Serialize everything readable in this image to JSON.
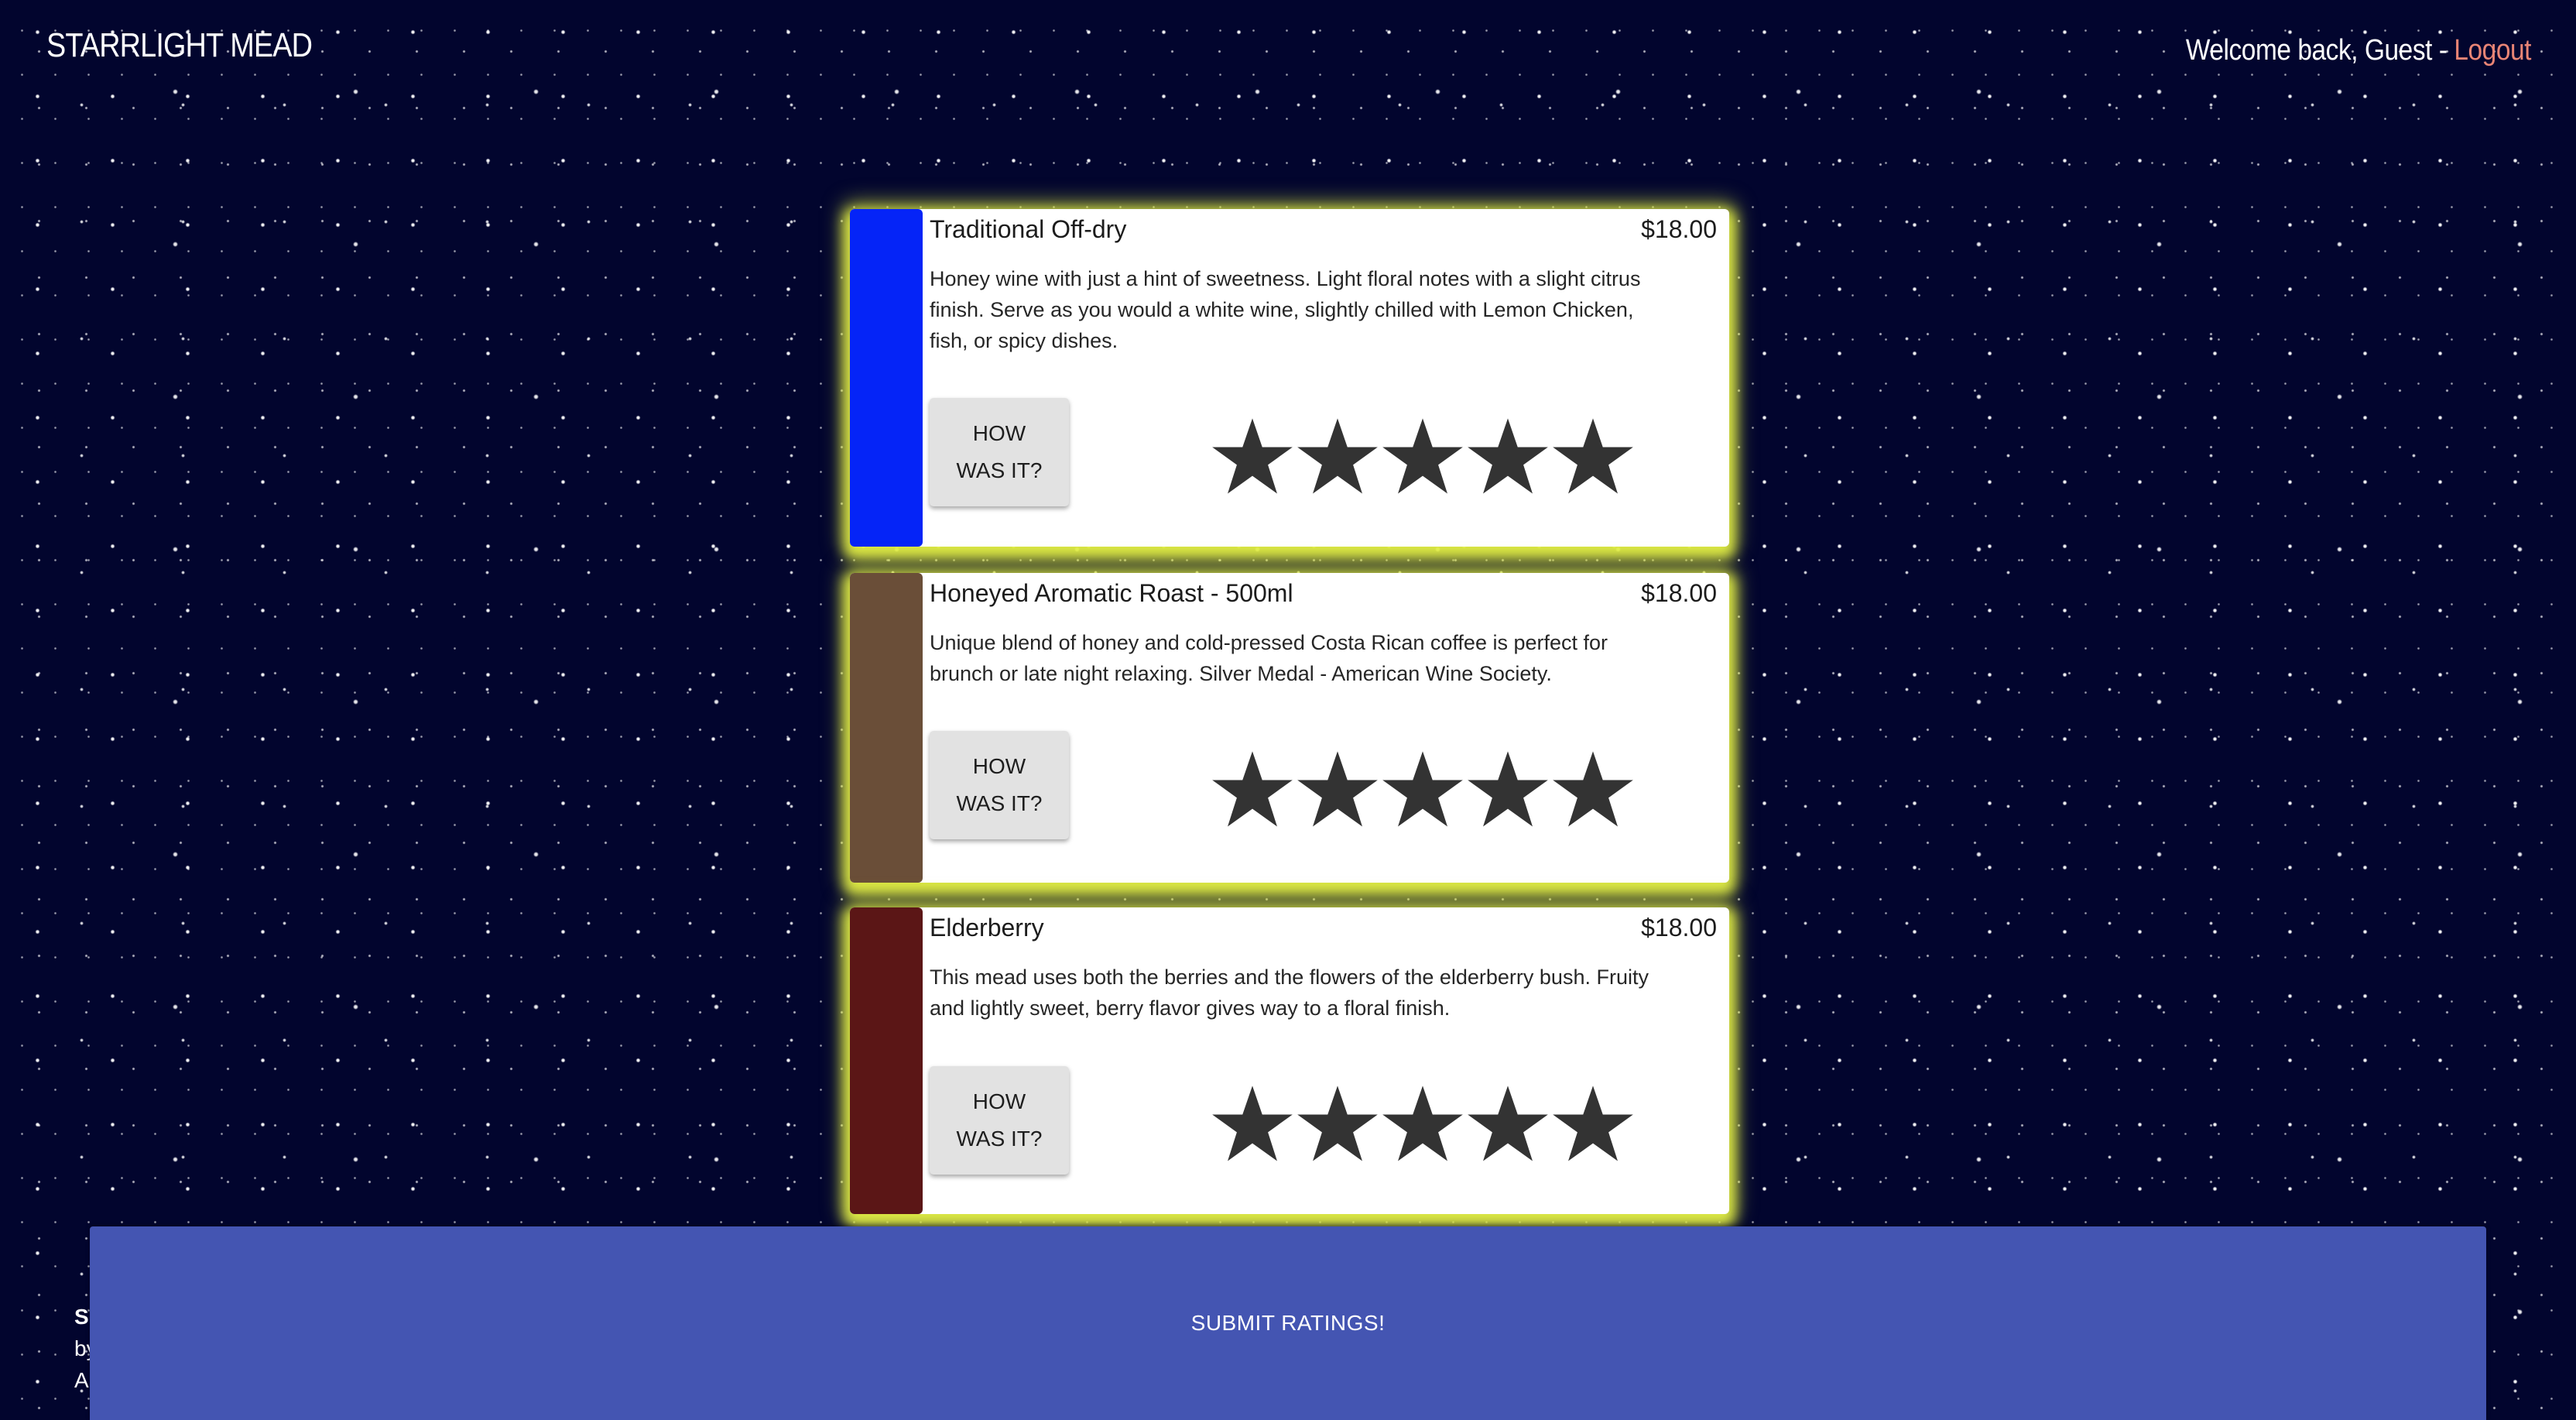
{
  "header": {
    "brand": "STARRLIGHT MEAD",
    "welcome_text": "Welcome back, Guest - ",
    "logout_label": "Logout"
  },
  "products": [
    {
      "name": "Traditional Off-dry",
      "price": "$18.00",
      "description": "Honey wine with just a hint of sweetness. Light floral notes with a slight citrus finish. Serve as you would a white wine, slightly chilled with Lemon Chicken, fish, or spicy dishes.",
      "rate_button": "HOW\nWAS IT?",
      "color": "#0524f7",
      "rating": 0,
      "max_rating": 5
    },
    {
      "name": "Honeyed Aromatic Roast - 500ml",
      "price": "$18.00",
      "description": "Unique blend of honey and cold-pressed Costa Rican coffee is perfect for brunch or late night relaxing. Silver Medal - American Wine Society.",
      "rate_button": "HOW\nWAS IT?",
      "color": "#6a4e38",
      "rating": 0,
      "max_rating": 5
    },
    {
      "name": "Elderberry",
      "price": "$18.00",
      "description": "This mead uses both the berries and the flowers of the elderberry bush. Fruity and lightly sweet, berry flavor gives way to a floral finish.",
      "rate_button": "HOW\nWAS IT?",
      "color": "#5b1616",
      "rating": 0,
      "max_rating": 5
    }
  ],
  "footer": {
    "line1": "S",
    "line2": "by",
    "line3": "A"
  },
  "submit": {
    "label": "SUBMIT RATINGS!"
  },
  "colors": {
    "background": "#02052e",
    "card_glow": "#e1ee46",
    "submit_bar": "#4455b2",
    "logout_link": "#e98575",
    "star": "#333333"
  }
}
